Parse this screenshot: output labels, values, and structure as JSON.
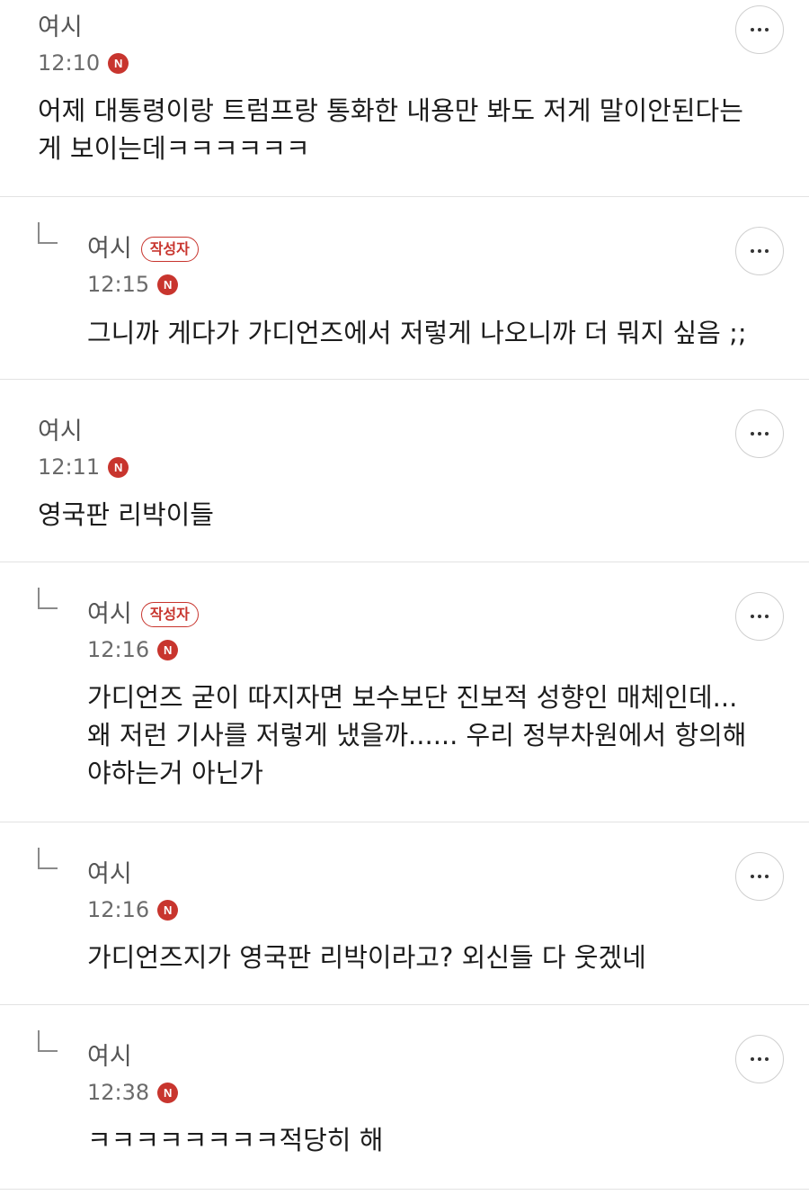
{
  "comments": [
    {
      "author": "여시",
      "time": "12:10",
      "new_badge": "N",
      "text": "어제 대통령이랑 트럼프랑 통화한 내용만 봐도 저게 말이안된다는\n게 보이는데ㅋㅋㅋㅋㅋㅋ",
      "is_reply": false,
      "writer_badge": ""
    },
    {
      "author": "여시",
      "time": "12:15",
      "new_badge": "N",
      "text": "그니까 게다가 가디언즈에서 저렇게 나오니까 더 뭐지 싶음 ;;",
      "is_reply": true,
      "writer_badge": "작성자"
    },
    {
      "author": "여시",
      "time": "12:11",
      "new_badge": "N",
      "text": "영국판 리박이들",
      "is_reply": false,
      "writer_badge": ""
    },
    {
      "author": "여시",
      "time": "12:16",
      "new_badge": "N",
      "text": "가디언즈 굳이 따지자면 보수보단 진보적 성향인 매체인데...\n왜 저런 기사를 저렇게 냈을까...... 우리 정부차원에서 항의해\n야하는거 아닌가",
      "is_reply": true,
      "writer_badge": "작성자"
    },
    {
      "author": "여시",
      "time": "12:16",
      "new_badge": "N",
      "text": "가디언즈지가 영국판 리박이라고? 외신들 다 웃겠네",
      "is_reply": true,
      "writer_badge": ""
    },
    {
      "author": "여시",
      "time": "12:38",
      "new_badge": "N",
      "text": "ㅋㅋㅋㅋㅋㅋㅋㅋ적당히 해",
      "is_reply": true,
      "writer_badge": ""
    }
  ],
  "icons": {
    "more": "more-options-icon",
    "reply": "reply-arrow-icon",
    "new": "new-badge-icon"
  },
  "colors": {
    "accent": "#c8352e",
    "divider": "#e2e2e2",
    "meta_text": "#6b6b6b"
  }
}
